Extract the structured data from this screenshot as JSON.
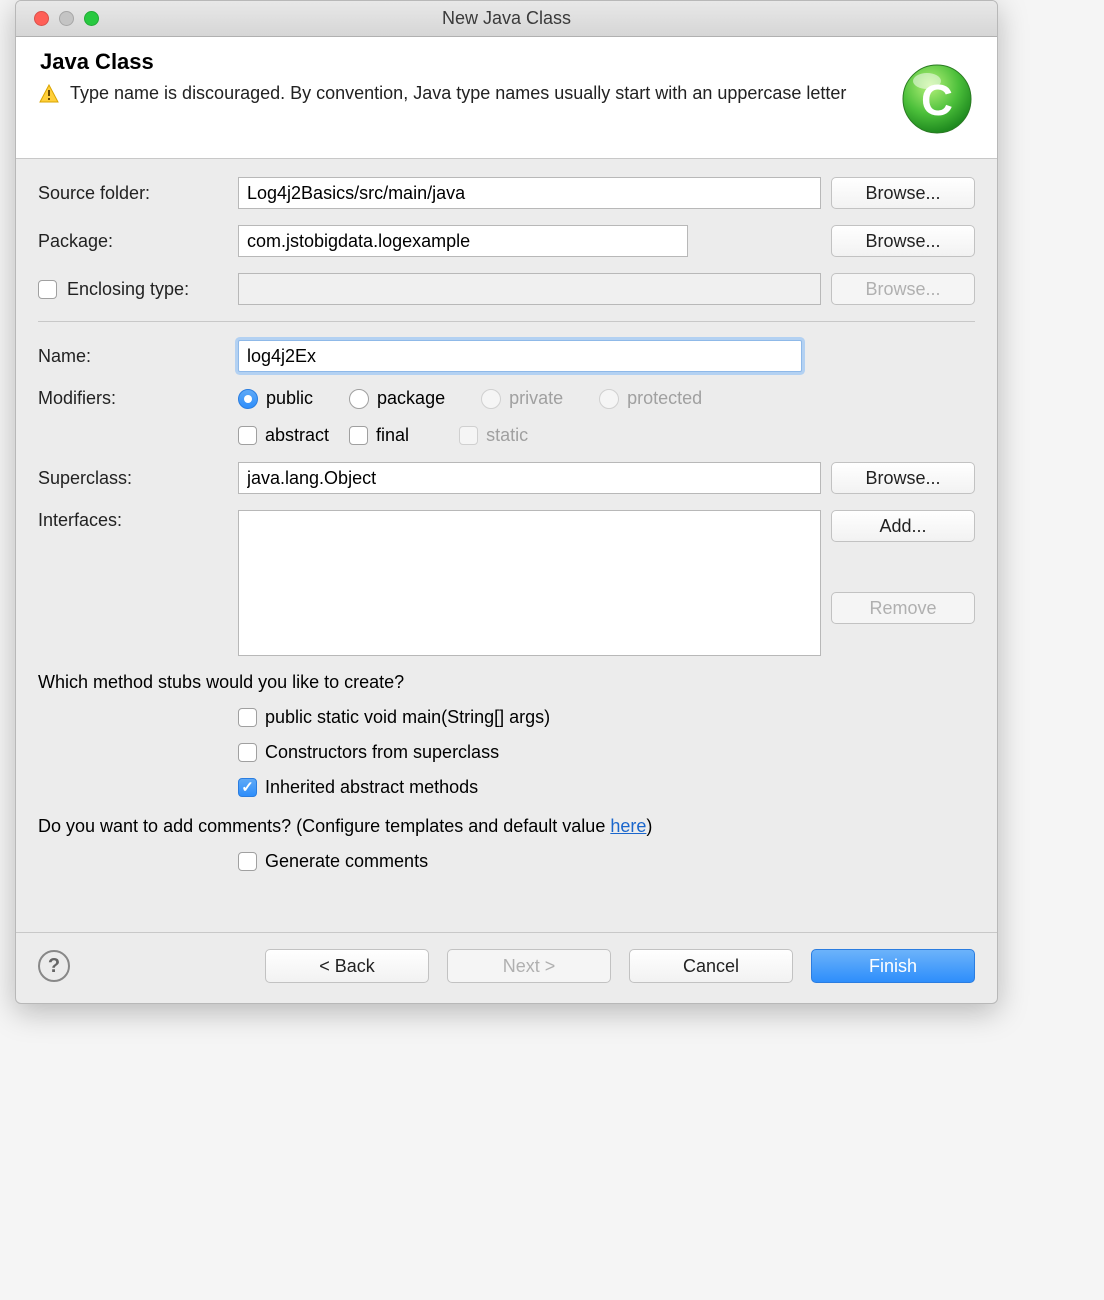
{
  "titlebar": {
    "title": "New Java Class"
  },
  "header": {
    "title": "Java Class",
    "desc": "Type name is discouraged. By convention, Java type names usually start with an uppercase letter"
  },
  "form": {
    "source_folder_label": "Source folder:",
    "source_folder_value": "Log4j2Basics/src/main/java",
    "package_label": "Package:",
    "package_value": "com.jstobigdata.logexample",
    "enclosing_label": "Enclosing type:",
    "enclosing_value": "",
    "name_label": "Name:",
    "name_value": "log4j2Ex",
    "modifiers_label": "Modifiers:",
    "mod_public": "public",
    "mod_package": "package",
    "mod_private": "private",
    "mod_protected": "protected",
    "mod_abstract": "abstract",
    "mod_final": "final",
    "mod_static": "static",
    "superclass_label": "Superclass:",
    "superclass_value": "java.lang.Object",
    "interfaces_label": "Interfaces:",
    "browse": "Browse...",
    "add": "Add...",
    "remove": "Remove",
    "stubs_question": "Which method stubs would you like to create?",
    "stub_main": "public static void main(String[] args)",
    "stub_constructors": "Constructors from superclass",
    "stub_inherited": "Inherited abstract methods",
    "comments_question_prefix": "Do you want to add comments? (Configure templates and default value ",
    "comments_question_link": "here",
    "comments_question_suffix": ")",
    "generate_comments": "Generate comments"
  },
  "footer": {
    "back": "< Back",
    "next": "Next >",
    "cancel": "Cancel",
    "finish": "Finish"
  }
}
